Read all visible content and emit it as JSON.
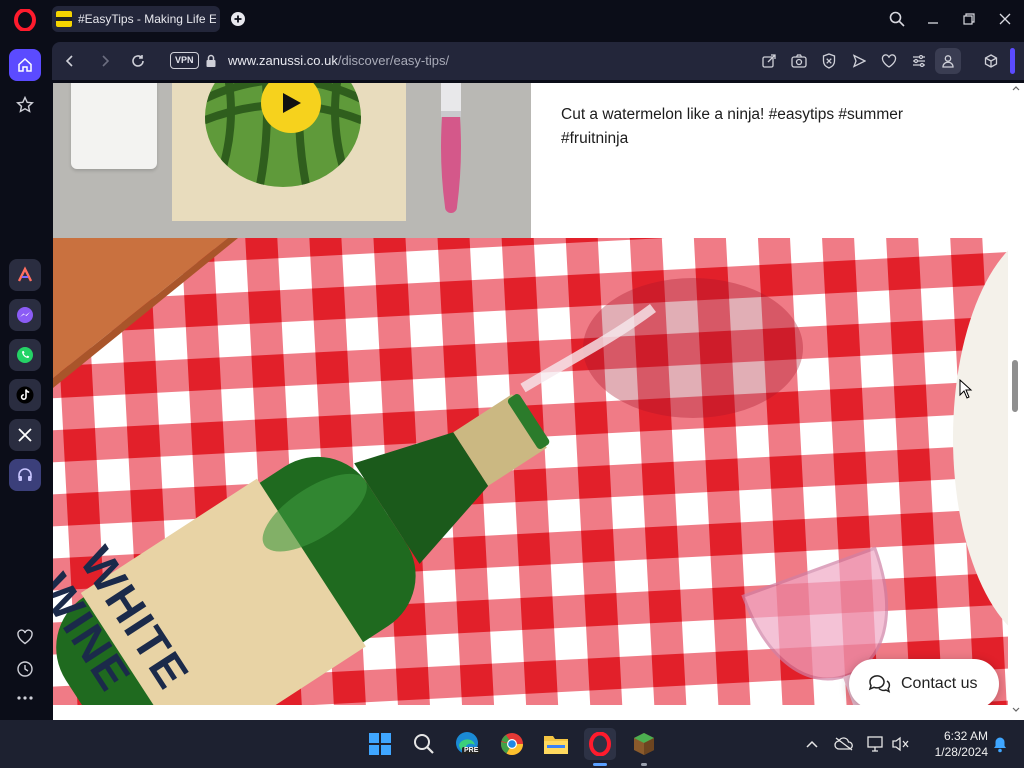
{
  "browser": {
    "tab_title": "#EasyTips - Making Life Easier",
    "vpn_label": "VPN",
    "url_host": "www.zanussi.co.uk",
    "url_path": "/discover/easy-tips/"
  },
  "page": {
    "caption_line1": "Cut a watermelon like a ninja! #easytips #summer",
    "caption_line2": "#fruitninja",
    "bottle_label_line1": "WHITE",
    "bottle_label_line2": "WINE",
    "contact_label": "Contact us"
  },
  "taskbar": {
    "time": "6:32 AM",
    "date": "1/28/2024",
    "edge_badge": "PRE"
  },
  "colors": {
    "accent": "#5b4bff",
    "opera_red": "#ff1b2d",
    "checker_red": "#e2202a",
    "play_yellow": "#f6d21d"
  }
}
